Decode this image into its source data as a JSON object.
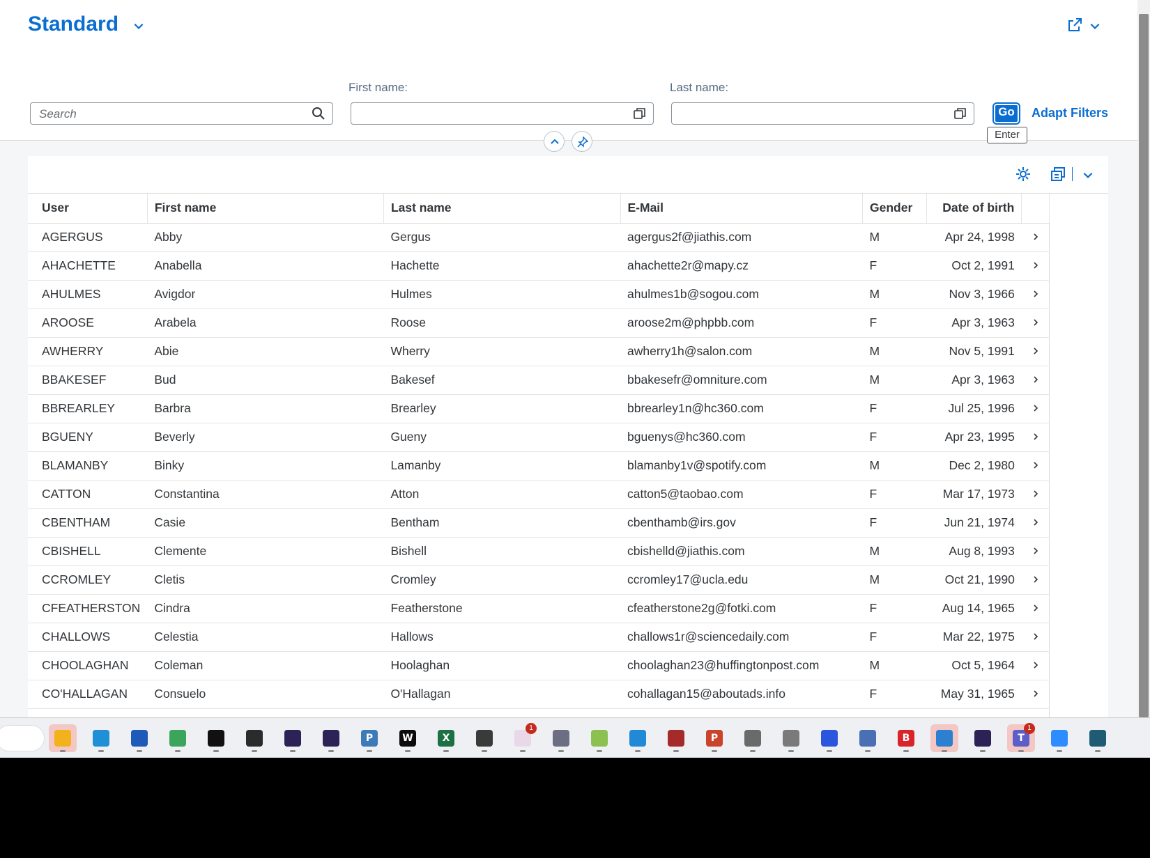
{
  "header": {
    "variant_title": "Standard",
    "search_placeholder": "Search",
    "first_name_label": "First name:",
    "last_name_label": "Last name:",
    "first_name_value": "",
    "last_name_value": "",
    "go_label": "Go",
    "go_tooltip": "Enter",
    "adapt_filters_label": "Adapt Filters"
  },
  "table": {
    "columns": [
      "User",
      "First name",
      "Last name",
      "E-Mail",
      "Gender",
      "Date of birth"
    ],
    "rows": [
      [
        "AGERGUS",
        "Abby",
        "Gergus",
        "agergus2f@jiathis.com",
        "M",
        "Apr 24, 1998"
      ],
      [
        "AHACHETTE",
        "Anabella",
        "Hachette",
        "ahachette2r@mapy.cz",
        "F",
        "Oct 2, 1991"
      ],
      [
        "AHULMES",
        "Avigdor",
        "Hulmes",
        "ahulmes1b@sogou.com",
        "M",
        "Nov 3, 1966"
      ],
      [
        "AROOSE",
        "Arabela",
        "Roose",
        "aroose2m@phpbb.com",
        "F",
        "Apr 3, 1963"
      ],
      [
        "AWHERRY",
        "Abie",
        "Wherry",
        "awherry1h@salon.com",
        "M",
        "Nov 5, 1991"
      ],
      [
        "BBAKESEF",
        "Bud",
        "Bakesef",
        "bbakesefr@omniture.com",
        "M",
        "Apr 3, 1963"
      ],
      [
        "BBREARLEY",
        "Barbra",
        "Brearley",
        "bbrearley1n@hc360.com",
        "F",
        "Jul 25, 1996"
      ],
      [
        "BGUENY",
        "Beverly",
        "Gueny",
        "bguenys@hc360.com",
        "F",
        "Apr 23, 1995"
      ],
      [
        "BLAMANBY",
        "Binky",
        "Lamanby",
        "blamanby1v@spotify.com",
        "M",
        "Dec 2, 1980"
      ],
      [
        "CATTON",
        "Constantina",
        "Atton",
        "catton5@taobao.com",
        "F",
        "Mar 17, 1973"
      ],
      [
        "CBENTHAM",
        "Casie",
        "Bentham",
        "cbenthamb@irs.gov",
        "F",
        "Jun 21, 1974"
      ],
      [
        "CBISHELL",
        "Clemente",
        "Bishell",
        "cbishelld@jiathis.com",
        "M",
        "Aug 8, 1993"
      ],
      [
        "CCROMLEY",
        "Cletis",
        "Cromley",
        "ccromley17@ucla.edu",
        "M",
        "Oct 21, 1990"
      ],
      [
        "CFEATHERSTON",
        "Cindra",
        "Featherstone",
        "cfeatherstone2g@fotki.com",
        "F",
        "Aug 14, 1965"
      ],
      [
        "CHALLOWS",
        "Celestia",
        "Hallows",
        "challows1r@sciencedaily.com",
        "F",
        "Mar 22, 1975"
      ],
      [
        "CHOOLAGHAN",
        "Coleman",
        "Hoolaghan",
        "choolaghan23@huffingtonpost.com",
        "M",
        "Oct 5, 1964"
      ],
      [
        "CO'HALLAGAN",
        "Consuelo",
        "O'Hallagan",
        "cohallagan15@aboutads.info",
        "F",
        "May 31, 1965"
      ]
    ]
  },
  "taskbar": {
    "apps": [
      {
        "name": "file-explorer",
        "color": "#f2b21b",
        "glyph": "",
        "active": true,
        "badge": ""
      },
      {
        "name": "edge",
        "color": "#1f8fd6",
        "glyph": "",
        "active": false,
        "badge": ""
      },
      {
        "name": "store",
        "color": "#1e5bb8",
        "glyph": "",
        "active": false,
        "badge": ""
      },
      {
        "name": "chrome",
        "color": "#3ba55c",
        "glyph": "",
        "active": false,
        "badge": ""
      },
      {
        "name": "terminal",
        "color": "#111111",
        "glyph": "",
        "active": false,
        "badge": ""
      },
      {
        "name": "obs",
        "color": "#2b2b2b",
        "glyph": "",
        "active": false,
        "badge": ""
      },
      {
        "name": "eclipse",
        "color": "#2c2255",
        "glyph": "",
        "active": false,
        "badge": ""
      },
      {
        "name": "eclipse-2",
        "color": "#2c2255",
        "glyph": "",
        "active": false,
        "badge": ""
      },
      {
        "name": "python-app",
        "color": "#3c7bb8",
        "glyph": "P",
        "active": false,
        "badge": ""
      },
      {
        "name": "webstorm",
        "color": "#0b0b0b",
        "glyph": "W",
        "active": false,
        "badge": ""
      },
      {
        "name": "excel",
        "color": "#1d7044",
        "glyph": "X",
        "active": false,
        "badge": ""
      },
      {
        "name": "console",
        "color": "#3a3a3a",
        "glyph": "",
        "active": false,
        "badge": ""
      },
      {
        "name": "slack",
        "color": "#e8d8e8",
        "glyph": "",
        "active": false,
        "badge": "1"
      },
      {
        "name": "keepass",
        "color": "#6c6f82",
        "glyph": "",
        "active": false,
        "badge": ""
      },
      {
        "name": "notepad-plus",
        "color": "#8cc152",
        "glyph": "",
        "active": false,
        "badge": ""
      },
      {
        "name": "vscode",
        "color": "#2189d6",
        "glyph": "",
        "active": false,
        "badge": ""
      },
      {
        "name": "gimp",
        "color": "#a52a2a",
        "glyph": "",
        "active": false,
        "badge": ""
      },
      {
        "name": "powerpoint",
        "color": "#c9442b",
        "glyph": "P",
        "active": false,
        "badge": ""
      },
      {
        "name": "settings",
        "color": "#6a6a6a",
        "glyph": "",
        "active": false,
        "badge": ""
      },
      {
        "name": "calculator",
        "color": "#7a7a7a",
        "glyph": "",
        "active": false,
        "badge": ""
      },
      {
        "name": "signal",
        "color": "#2a56dd",
        "glyph": "",
        "active": false,
        "badge": ""
      },
      {
        "name": "network-tool",
        "color": "#4a6fb5",
        "glyph": "",
        "active": false,
        "badge": ""
      },
      {
        "name": "bitwarden-b",
        "color": "#d9252a",
        "glyph": "B",
        "active": false,
        "badge": ""
      },
      {
        "name": "sap-logon",
        "color": "#2d7fd0",
        "glyph": "",
        "active": true,
        "badge": ""
      },
      {
        "name": "eclipse-3",
        "color": "#2c2255",
        "glyph": "",
        "active": false,
        "badge": ""
      },
      {
        "name": "teams",
        "color": "#5b5fc7",
        "glyph": "T",
        "active": true,
        "badge": "1"
      },
      {
        "name": "zoom",
        "color": "#2d8cff",
        "glyph": "",
        "active": false,
        "badge": ""
      },
      {
        "name": "sublime",
        "color": "#1f5c73",
        "glyph": "",
        "active": false,
        "badge": ""
      }
    ]
  }
}
